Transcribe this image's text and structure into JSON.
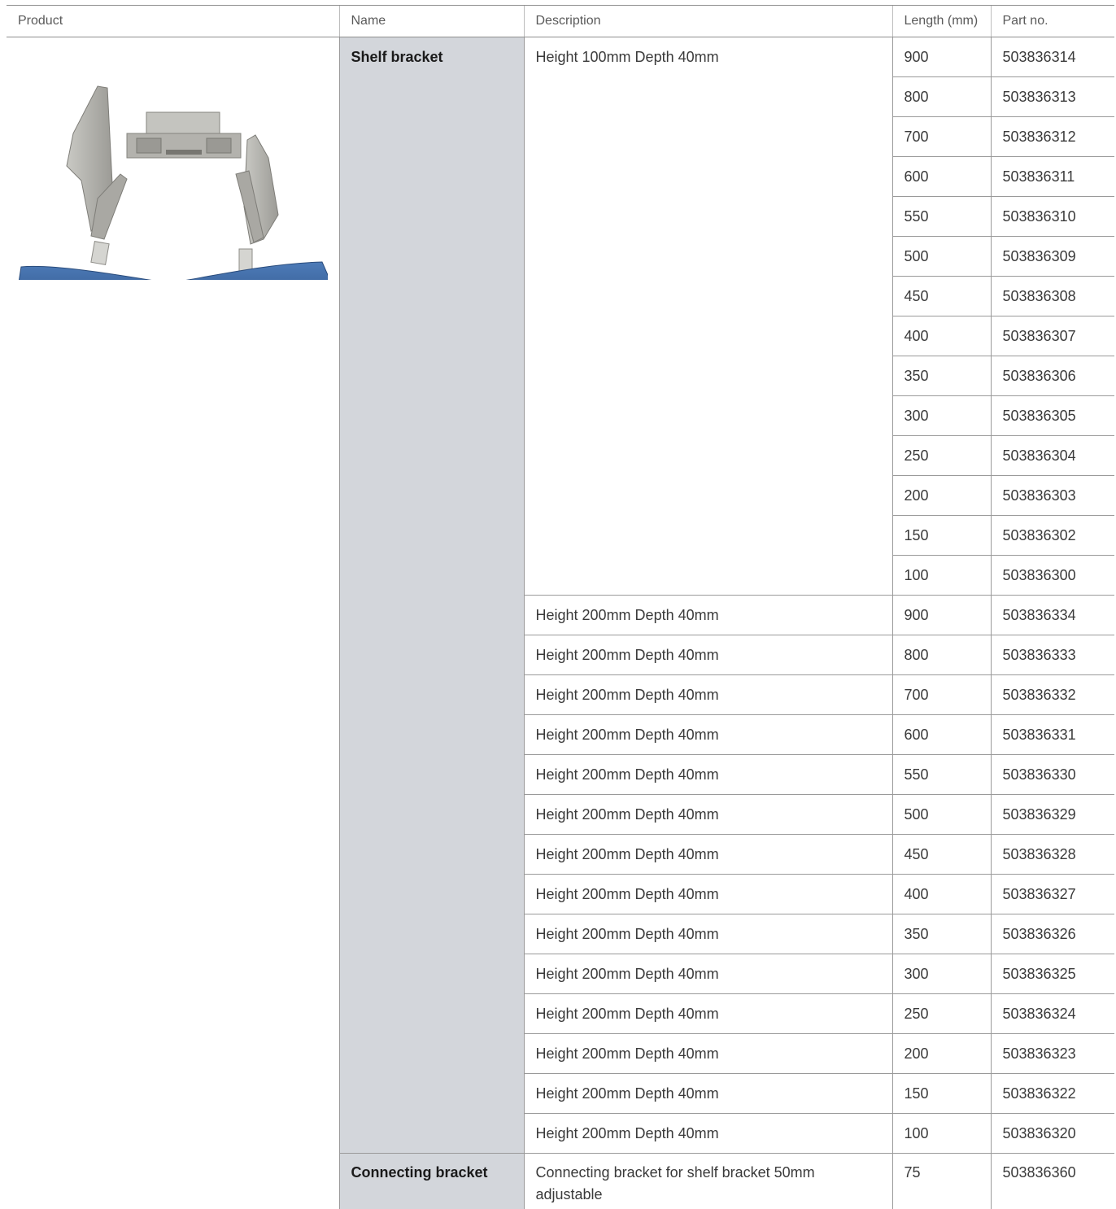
{
  "table": {
    "headers": {
      "product": "Product",
      "name": "Name",
      "description": "Description",
      "length": "Length (mm)",
      "part_no": "Part no."
    },
    "shelf_bracket": {
      "name": "Shelf bracket",
      "rows": [
        {
          "description": "Height 100mm Depth 40mm",
          "length": "900",
          "part_no": "503836314"
        },
        {
          "description": "",
          "length": "800",
          "part_no": "503836313"
        },
        {
          "description": "",
          "length": "700",
          "part_no": "503836312"
        },
        {
          "description": "",
          "length": "600",
          "part_no": "503836311"
        },
        {
          "description": "",
          "length": "550",
          "part_no": "503836310"
        },
        {
          "description": "",
          "length": "500",
          "part_no": "503836309"
        },
        {
          "description": "",
          "length": "450",
          "part_no": "503836308"
        },
        {
          "description": "",
          "length": "400",
          "part_no": "503836307"
        },
        {
          "description": "",
          "length": "350",
          "part_no": "503836306"
        },
        {
          "description": "",
          "length": "300",
          "part_no": "503836305"
        },
        {
          "description": "",
          "length": "250",
          "part_no": "503836304"
        },
        {
          "description": "",
          "length": "200",
          "part_no": "503836303"
        },
        {
          "description": "",
          "length": "150",
          "part_no": "503836302"
        },
        {
          "description": "",
          "length": "100",
          "part_no": "503836300"
        },
        {
          "description": "Height 200mm Depth 40mm",
          "length": "900",
          "part_no": "503836334"
        },
        {
          "description": "Height 200mm Depth 40mm",
          "length": "800",
          "part_no": "503836333"
        },
        {
          "description": "Height 200mm Depth 40mm",
          "length": "700",
          "part_no": "503836332"
        },
        {
          "description": "Height 200mm Depth 40mm",
          "length": "600",
          "part_no": "503836331"
        },
        {
          "description": "Height 200mm Depth 40mm",
          "length": "550",
          "part_no": "503836330"
        },
        {
          "description": "Height 200mm Depth 40mm",
          "length": "500",
          "part_no": "503836329"
        },
        {
          "description": "Height 200mm Depth 40mm",
          "length": "450",
          "part_no": "503836328"
        },
        {
          "description": "Height 200mm Depth 40mm",
          "length": "400",
          "part_no": "503836327"
        },
        {
          "description": "Height 200mm Depth 40mm",
          "length": "350",
          "part_no": "503836326"
        },
        {
          "description": "Height 200mm Depth 40mm",
          "length": "300",
          "part_no": "503836325"
        },
        {
          "description": "Height 200mm Depth 40mm",
          "length": "250",
          "part_no": "503836324"
        },
        {
          "description": "Height 200mm Depth 40mm",
          "length": "200",
          "part_no": "503836323"
        },
        {
          "description": "Height 200mm Depth 40mm",
          "length": "150",
          "part_no": "503836322"
        },
        {
          "description": "Height 200mm Depth 40mm",
          "length": "100",
          "part_no": "503836320"
        }
      ]
    },
    "connecting_bracket": {
      "name": "Connecting bracket",
      "description": "Connecting bracket for shelf bracket 50mm adjustable",
      "length": "75",
      "part_no": "503836360"
    }
  },
  "product_image": {
    "icon": "shelf-bracket-product-photo",
    "colors": {
      "metal": "#b9b9b5",
      "metal_dark": "#8f8e89",
      "strip": "#3f6aa3"
    }
  }
}
